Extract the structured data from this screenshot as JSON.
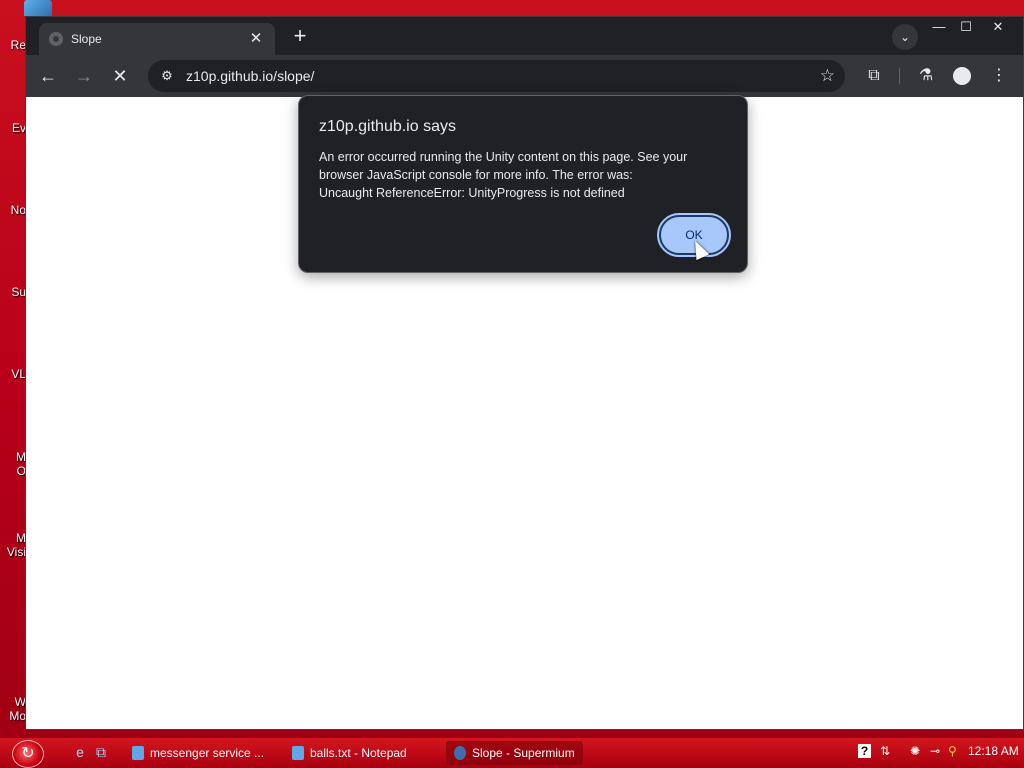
{
  "desktop": {
    "icons": [
      {
        "label": "Re"
      },
      {
        "label": "Ev"
      },
      {
        "label": "No"
      },
      {
        "label": "Su"
      },
      {
        "label": "VL"
      },
      {
        "label": "M"
      },
      {
        "label": "O"
      },
      {
        "label": "M"
      },
      {
        "label": "Visi"
      },
      {
        "label": "W"
      },
      {
        "label": "Mo"
      }
    ]
  },
  "browser": {
    "tab": {
      "title": "Slope",
      "close": "✕"
    },
    "new_tab": "+",
    "tab_search": "⌄",
    "window_controls": {
      "minimize": "—",
      "maximize": "☐",
      "close": "✕"
    },
    "nav": {
      "back": "←",
      "forward": "→",
      "stop": "✕"
    },
    "omnibox": {
      "tune_icon": "⚙",
      "url": "z10p.github.io/slope/",
      "star": "☆"
    },
    "toolbar_icons": {
      "extensions": "⧉",
      "labs": "⚗",
      "menu": "⋮"
    }
  },
  "dialog": {
    "title": "z10p.github.io says",
    "message_lines": [
      "An error occurred running the Unity content on this page. See your",
      "browser JavaScript console for more info. The error was:",
      "Uncaught ReferenceError: UnityProgress is not defined"
    ],
    "ok_label": "OK"
  },
  "taskbar": {
    "start_icon": "↻",
    "quick_launch": [
      "e",
      "⧉"
    ],
    "tasks": [
      {
        "label": "messenger service ..."
      },
      {
        "label": "balls.txt - Notepad"
      },
      {
        "label": "Slope - Supermium"
      }
    ],
    "tray": {
      "help": "?",
      "clock": "12:18 AM"
    }
  },
  "colors": {
    "desktop_bg": "#c8101e",
    "browser_frame": "#202124",
    "toolbar": "#35363a",
    "ok_button": "#a8c7fa"
  }
}
